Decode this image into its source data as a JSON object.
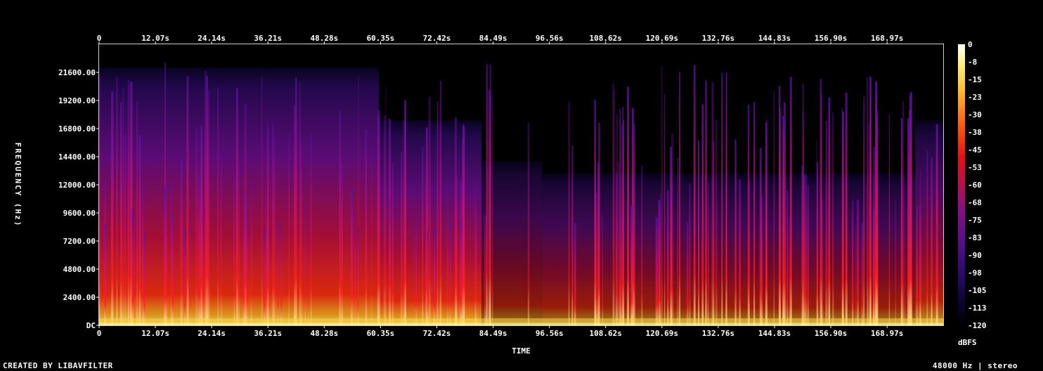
{
  "chart_data": {
    "type": "heatmap",
    "xlabel": "TIME",
    "ylabel": "FREQUENCY (Hz)",
    "x_ticks": [
      "0",
      "12.07s",
      "24.14s",
      "36.21s",
      "48.28s",
      "60.35s",
      "72.42s",
      "84.49s",
      "96.56s",
      "108.62s",
      "120.69s",
      "132.76s",
      "144.83s",
      "156.90s",
      "168.97s"
    ],
    "x_tick_values": [
      0,
      12.07,
      24.14,
      36.21,
      48.28,
      60.35,
      72.42,
      84.49,
      96.56,
      108.62,
      120.69,
      132.76,
      144.83,
      156.9,
      168.97
    ],
    "xlim": [
      0,
      181
    ],
    "y_ticks": [
      "DC",
      "2400.00",
      "4800.00",
      "7200.00",
      "9600.00",
      "12000.00",
      "14400.00",
      "16800.00",
      "19200.00",
      "21600.00"
    ],
    "y_tick_values": [
      0,
      2400,
      4800,
      7200,
      9600,
      12000,
      14400,
      16800,
      19200,
      21600
    ],
    "ylim": [
      0,
      24000
    ],
    "colorbar": {
      "label": "dBFS",
      "ticks": [
        "0",
        "-8",
        "-15",
        "-23",
        "-30",
        "-38",
        "-45",
        "-53",
        "-60",
        "-68",
        "-75",
        "-83",
        "-90",
        "-98",
        "-105",
        "-113",
        "-120"
      ],
      "range": [
        -120,
        0
      ],
      "colors": [
        "#000000",
        "#0a0432",
        "#2a0a6a",
        "#5a0e8a",
        "#8a1080",
        "#c01040",
        "#e81010",
        "#ff6010",
        "#ffc030",
        "#fff080",
        "#ffffff"
      ]
    }
  },
  "footer": {
    "left": "CREATED BY LIBAVFILTER",
    "right": "48000 Hz | stereo"
  }
}
